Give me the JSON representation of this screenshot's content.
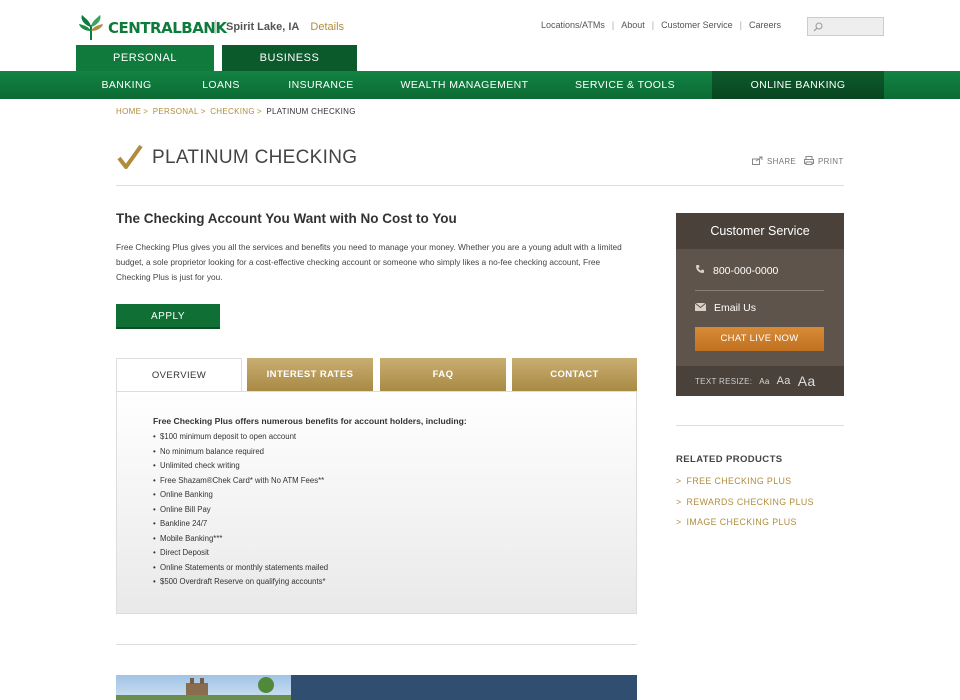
{
  "header": {
    "brand": "CENTRALBANK",
    "location": "Spirit Lake, IA",
    "location_link": "Details",
    "util_nav": [
      "Locations/ATMs",
      "About",
      "Customer Service",
      "Careers"
    ],
    "search_placeholder": ""
  },
  "segments": {
    "personal": "PERSONAL",
    "business": "BUSINESS"
  },
  "main_nav": [
    "BANKING",
    "LOANS",
    "INSURANCE",
    "WEALTH MANAGEMENT",
    "SERVICE & TOOLS",
    "ONLINE BANKING"
  ],
  "breadcrumb": [
    "HOME",
    "PERSONAL",
    "CHECKING",
    "PLATINUM CHECKING"
  ],
  "page": {
    "title": "PLATINUM CHECKING",
    "share": "SHARE",
    "print": "PRINT",
    "heading": "The Checking Account You Want with No Cost to You",
    "intro": "Free Checking Plus gives you all the services and benefits you need to manage your money. Whether you are a young adult with a limited budget, a sole proprietor looking for a cost-effective checking account or someone who simply likes a no-fee checking account, Free Checking Plus is just for you.",
    "apply": "APPLY"
  },
  "tabs": [
    "OVERVIEW",
    "INTEREST RATES",
    "FAQ",
    "CONTACT"
  ],
  "overview": {
    "lead": "Free Checking Plus offers numerous benefits for account holders, including:",
    "items": [
      "$100 minimum deposit to open account",
      "No minimum balance required",
      "Unlimited check writing",
      "Free Shazam®Chek Card* with No ATM Fees**",
      "Online Banking",
      "Online Bill Pay",
      "Bankline 24/7",
      "Mobile Banking***",
      "Direct Deposit",
      "Online Statements or monthly statements mailed",
      "$500 Overdraft Reserve on qualifying accounts*"
    ]
  },
  "sidebar": {
    "title": "Customer Service",
    "phone": "800-000-0000",
    "email": "Email Us",
    "chat": "CHAT LIVE NOW",
    "resize_label": "TEXT RESIZE:",
    "resize_options": [
      "Aa",
      "Aa",
      "Aa"
    ]
  },
  "related": {
    "heading": "RELATED PRODUCTS",
    "items": [
      "FREE CHECKING PLUS",
      "REWARDS CHECKING PLUS",
      "IMAGE CHECKING PLUS"
    ]
  },
  "colors": {
    "brand_green": "#0f7a3c",
    "gold": "#b08d3c",
    "sidebar_brown": "#5e544b",
    "chat_orange": "#d98c38"
  }
}
